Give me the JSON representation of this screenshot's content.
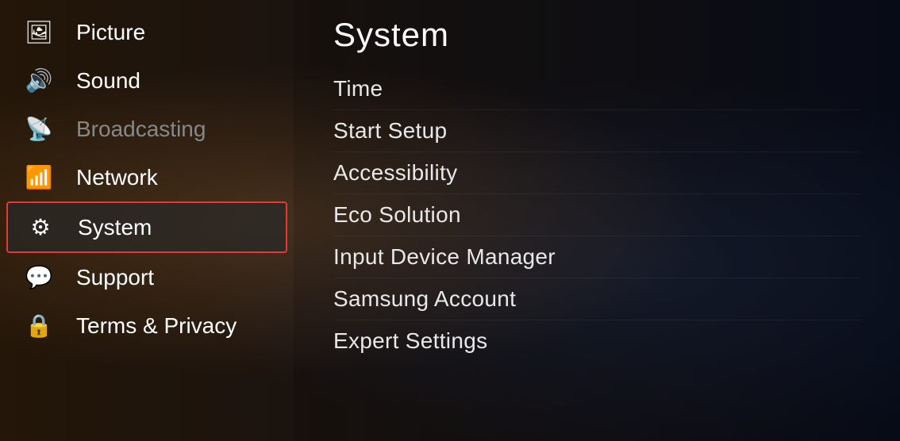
{
  "background": {
    "alt": "TV background scene"
  },
  "sidebar": {
    "items": [
      {
        "id": "picture",
        "label": "Picture",
        "icon": "🖼",
        "active": false,
        "dimmed": false
      },
      {
        "id": "sound",
        "label": "Sound",
        "icon": "🔊",
        "active": false,
        "dimmed": false
      },
      {
        "id": "broadcasting",
        "label": "Broadcasting",
        "icon": "📡",
        "active": false,
        "dimmed": true
      },
      {
        "id": "network",
        "label": "Network",
        "icon": "📶",
        "active": false,
        "dimmed": false
      },
      {
        "id": "system",
        "label": "System",
        "icon": "⚙",
        "active": true,
        "dimmed": false
      },
      {
        "id": "support",
        "label": "Support",
        "icon": "💬",
        "active": false,
        "dimmed": false
      },
      {
        "id": "terms",
        "label": "Terms & Privacy",
        "icon": "🔒",
        "active": false,
        "dimmed": false
      }
    ]
  },
  "panel": {
    "title": "System",
    "menu_items": [
      {
        "id": "time",
        "label": "Time"
      },
      {
        "id": "start-setup",
        "label": "Start Setup"
      },
      {
        "id": "accessibility",
        "label": "Accessibility"
      },
      {
        "id": "eco-solution",
        "label": "Eco Solution"
      },
      {
        "id": "input-device-manager",
        "label": "Input Device Manager"
      },
      {
        "id": "samsung-account",
        "label": "Samsung Account"
      },
      {
        "id": "expert-settings",
        "label": "Expert Settings"
      }
    ]
  }
}
